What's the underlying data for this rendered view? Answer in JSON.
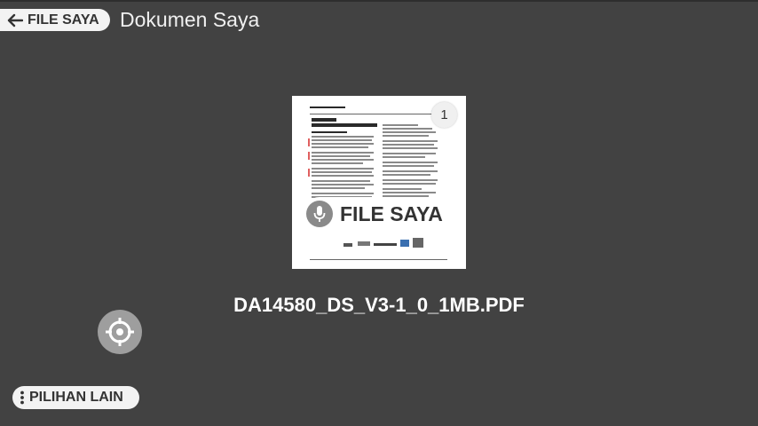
{
  "header": {
    "back_label": "FILE SAYA",
    "title": "Dokumen Saya"
  },
  "document": {
    "page_number": "1",
    "voice_hint_label": "FILE SAYA",
    "file_name": "DA14580_DS_V3-1_0_1MB.PDF"
  },
  "footer": {
    "more_options_label": "PILIHAN LAIN"
  },
  "colors": {
    "background": "#424242",
    "pill_background": "#f3f3f3",
    "text_light": "#ffffff",
    "accent_button": "#9e9e9e"
  },
  "icons": {
    "back": "arrow-left-icon",
    "page_badge": "page-number-badge",
    "voice": "microphone-icon",
    "target": "crosshair-target-icon",
    "more": "vertical-dots-icon"
  }
}
